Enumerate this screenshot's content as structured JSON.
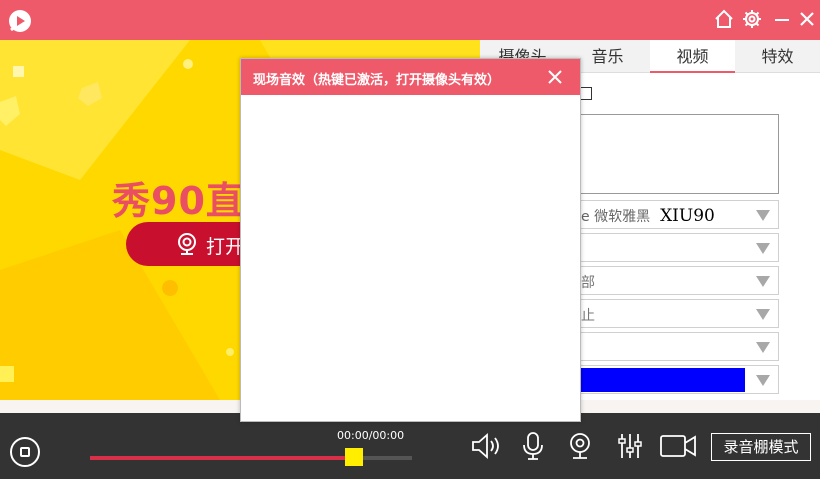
{
  "colors": {
    "brand": "#ee5a6a",
    "banner": "#ffd800",
    "button_red": "#c8102e",
    "progress_fill": "#d9304a",
    "thumb": "#ffee00",
    "swatch": "#0000ff"
  },
  "titlebar": {
    "icons": [
      "app-logo-icon",
      "home-icon",
      "gear-icon",
      "minimize-icon",
      "close-icon"
    ]
  },
  "banner": {
    "title": "秀90直",
    "open_camera_label": "打开"
  },
  "right_panel": {
    "tabs": [
      {
        "label": "摄像头"
      },
      {
        "label": "音乐"
      },
      {
        "label": "视频",
        "active": true
      },
      {
        "label": "特效"
      }
    ],
    "dropdowns": {
      "font": {
        "name": "e 微软雅黑",
        "sample": "XIU90"
      },
      "position": {
        "value": "部"
      },
      "motion": {
        "value": "止"
      }
    }
  },
  "dialog": {
    "title": "现场音效（热键已激活，打开摄像头有效）"
  },
  "controls": {
    "time": "00:00/00:00",
    "progress_fraction": 0.82,
    "studio_mode_label": "录音棚模式"
  }
}
